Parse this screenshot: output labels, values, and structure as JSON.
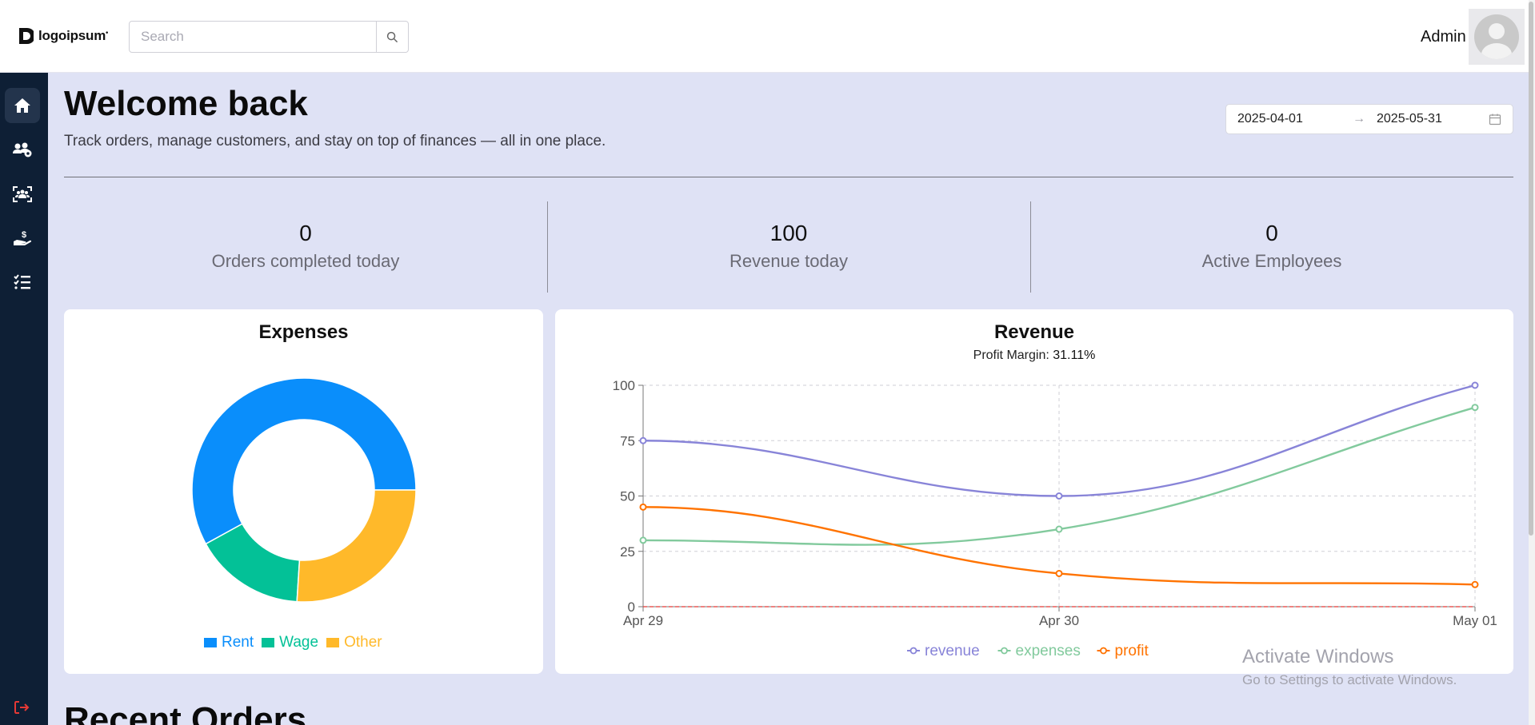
{
  "header": {
    "logo_text": "logoipsum",
    "search_placeholder": "Search",
    "user_name": "Admin",
    "icons": [
      "search-icon",
      "user-avatar"
    ]
  },
  "sidebar": {
    "items": [
      {
        "icon": "home-icon",
        "active": true
      },
      {
        "icon": "customers-icon",
        "active": false
      },
      {
        "icon": "employees-icon",
        "active": false
      },
      {
        "icon": "finance-icon",
        "active": false
      },
      {
        "icon": "orders-list-icon",
        "active": false
      }
    ],
    "logout_icon": "logout-icon"
  },
  "main": {
    "title": "Welcome back",
    "subtitle": "Track orders, manage customers, and stay on top of finances — all in one place.",
    "date_range": {
      "start": "2025-04-01",
      "arrow": "→",
      "end": "2025-05-31"
    },
    "stats": [
      {
        "value": "0",
        "label": "Orders completed today"
      },
      {
        "value": "100",
        "label": "Revenue today"
      },
      {
        "value": "0",
        "label": "Active Employees"
      }
    ],
    "recent_orders_title": "Recent Orders"
  },
  "expenses_card": {
    "title": "Expenses",
    "legend": [
      {
        "label": "Rent",
        "color": "#0a8efb"
      },
      {
        "label": "Wage",
        "color": "#03c197"
      },
      {
        "label": "Other",
        "color": "#ffb92a"
      }
    ]
  },
  "revenue_card": {
    "title": "Revenue",
    "profit_margin_label": "Profit Margin:",
    "profit_margin_value": "31.11%"
  },
  "watermark": {
    "line1": "Activate Windows",
    "line2": "Go to Settings to activate Windows."
  },
  "chart_data": [
    {
      "type": "pie",
      "title": "Expenses",
      "donut": true,
      "categories": [
        "Rent",
        "Wage",
        "Other"
      ],
      "values": [
        58,
        16,
        26
      ],
      "colors": [
        "#0a8efb",
        "#03c197",
        "#ffb92a"
      ],
      "legend": "bottom"
    },
    {
      "type": "line",
      "title": "Revenue",
      "subtitle": "Profit Margin: 31.11%",
      "categories": [
        "Apr 29",
        "Apr 30",
        "May 01"
      ],
      "ylim": [
        0,
        100
      ],
      "yticks": [
        0,
        25,
        50,
        75,
        100
      ],
      "grid": true,
      "legend": "bottom",
      "series": [
        {
          "name": "revenue",
          "values": [
            75,
            50,
            100
          ],
          "color": "#8884d8"
        },
        {
          "name": "expenses",
          "values": [
            30,
            35,
            90
          ],
          "color": "#82ca9d"
        },
        {
          "name": "profit",
          "values": [
            45,
            15,
            10
          ],
          "color": "#ff7300"
        }
      ],
      "reference_line": {
        "y": 0,
        "color": "#e53935"
      }
    }
  ]
}
